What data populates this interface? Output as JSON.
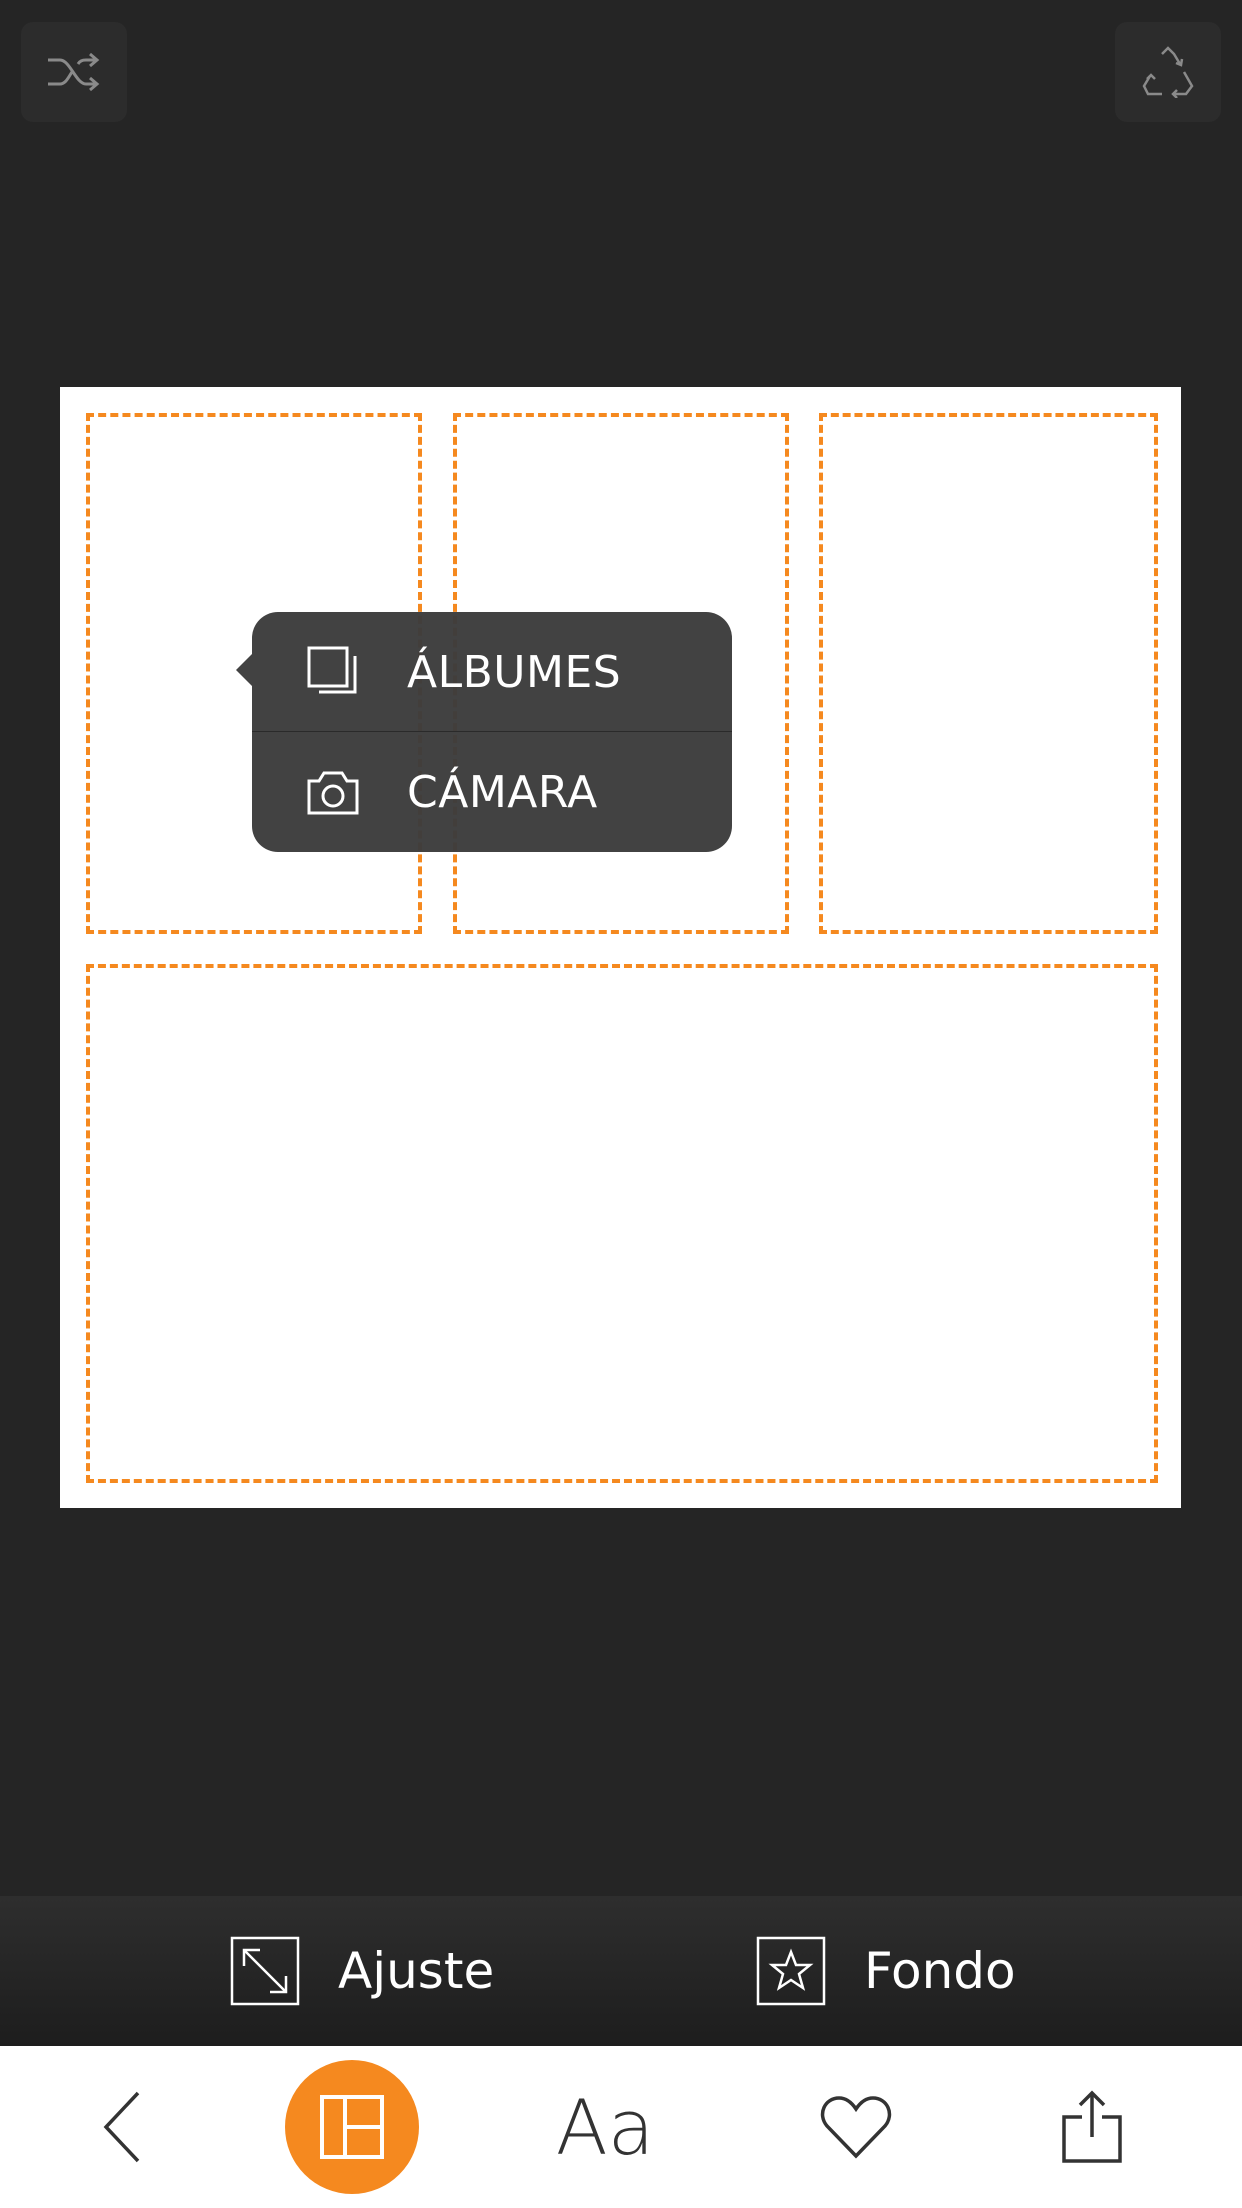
{
  "top_bar": {
    "left_icon": "shuffle-icon",
    "right_icon": "recycle-icon"
  },
  "popup": {
    "items": [
      {
        "label": "ÁLBUMES",
        "icon": "albums-icon"
      },
      {
        "label": "CÁMARA",
        "icon": "camera-icon"
      }
    ]
  },
  "toolbar": {
    "ajuste_label": "Ajuste",
    "ajuste_icon": "resize-icon",
    "fondo_label": "Fondo",
    "fondo_icon": "star-frame-icon"
  },
  "tabbar": {
    "text_label": "Aa",
    "icons": [
      "back-icon",
      "layout-icon",
      "text-icon",
      "heart-icon",
      "share-icon"
    ]
  },
  "colors": {
    "accent": "#f5891f",
    "background": "#252525",
    "canvas": "#ffffff",
    "popup": "#3c3c3c"
  }
}
